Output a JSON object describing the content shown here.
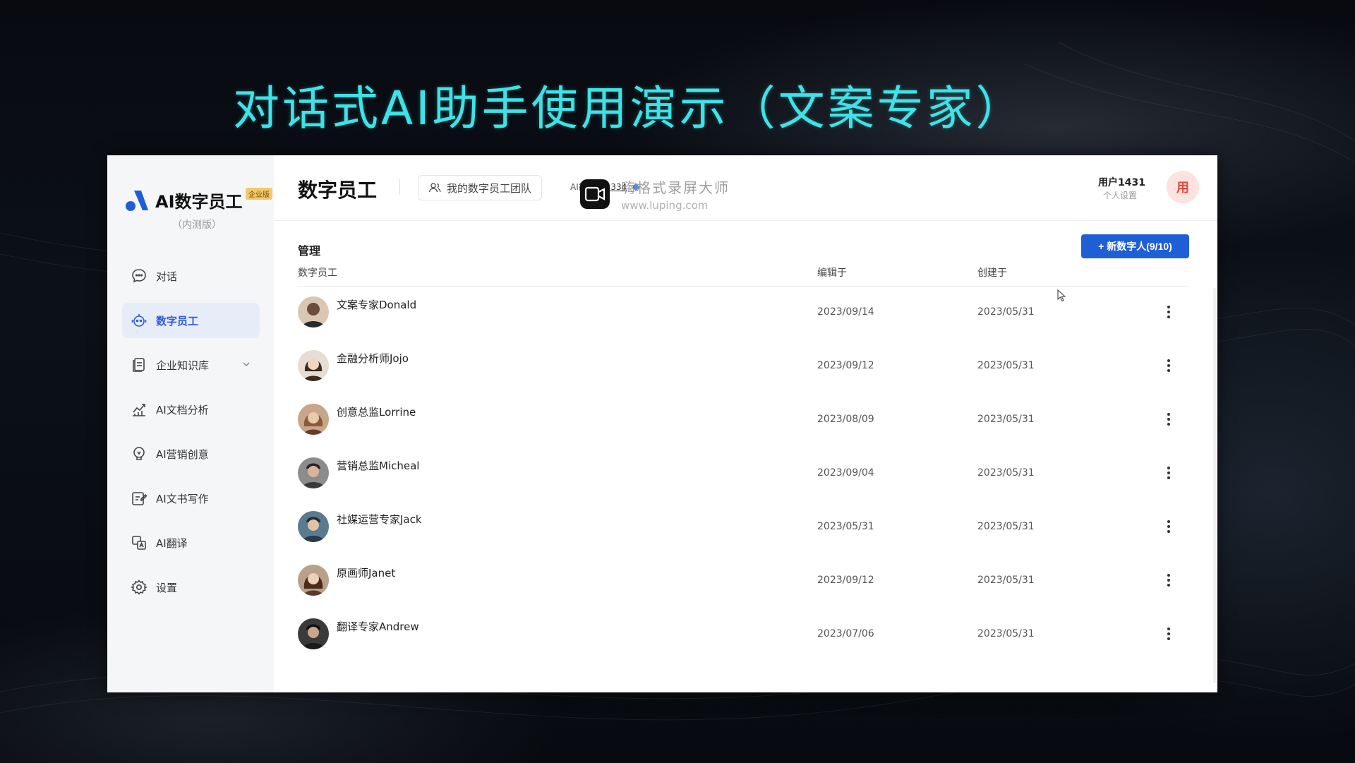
{
  "slide": {
    "title": "对话式AI助手使用演示（文案专家）"
  },
  "brand": {
    "name": "AI数字员工",
    "badge": "企业版",
    "sub": "（内测版）"
  },
  "nav": [
    {
      "label": "对话",
      "icon": "chat-icon",
      "active": false
    },
    {
      "label": "数字员工",
      "icon": "robot-icon",
      "active": true
    },
    {
      "label": "企业知识库",
      "icon": "knowledge-base-icon",
      "active": false,
      "expandable": true
    },
    {
      "label": "AI文档分析",
      "icon": "chart-icon",
      "active": false
    },
    {
      "label": "AI营销创意",
      "icon": "lightbulb-icon",
      "active": false
    },
    {
      "label": "AI文书写作",
      "icon": "edit-document-icon",
      "active": false
    },
    {
      "label": "AI翻译",
      "icon": "translate-icon",
      "active": false
    },
    {
      "label": "设置",
      "icon": "gear-icon",
      "active": false
    }
  ],
  "header": {
    "title": "数字员工",
    "team_button": "我的数字员工团队",
    "energy_label": "AI能量：",
    "energy_value": "1334",
    "user_name": "用户1431",
    "user_sub": "个人设置",
    "user_avatar": "用"
  },
  "watermark": {
    "text": "嗨格式录屏大师",
    "url": "www.luping.com"
  },
  "table": {
    "section_title": "管理",
    "new_button": "+ 新数字人(9/10)",
    "columns": [
      "数字员工",
      "编辑于",
      "创建于"
    ],
    "rows": [
      {
        "name": "文案专家Donald",
        "edited": "2023/09/14",
        "created": "2023/05/31",
        "avatar_color": "#6b4e3a"
      },
      {
        "name": "金融分析师Jojo",
        "edited": "2023/09/12",
        "created": "2023/05/31",
        "avatar_color": "#3a2a22"
      },
      {
        "name": "创意总监Lorrine",
        "edited": "2023/08/09",
        "created": "2023/05/31",
        "avatar_color": "#8a5a3a"
      },
      {
        "name": "营销总监Micheal",
        "edited": "2023/09/04",
        "created": "2023/05/31",
        "avatar_color": "#4a3a30"
      },
      {
        "name": "社媒运营专家Jack",
        "edited": "2023/05/31",
        "created": "2023/05/31",
        "avatar_color": "#3a4a5a"
      },
      {
        "name": "原画师Janet",
        "edited": "2023/09/12",
        "created": "2023/05/31",
        "avatar_color": "#5a3a2a"
      },
      {
        "name": "翻译专家Andrew",
        "edited": "2023/07/06",
        "created": "2023/05/31",
        "avatar_color": "#2a2a2a"
      }
    ]
  },
  "colors": {
    "accent": "#1f5fd6",
    "title": "#3fe2e6",
    "active_nav_bg": "#e7ecf9"
  }
}
